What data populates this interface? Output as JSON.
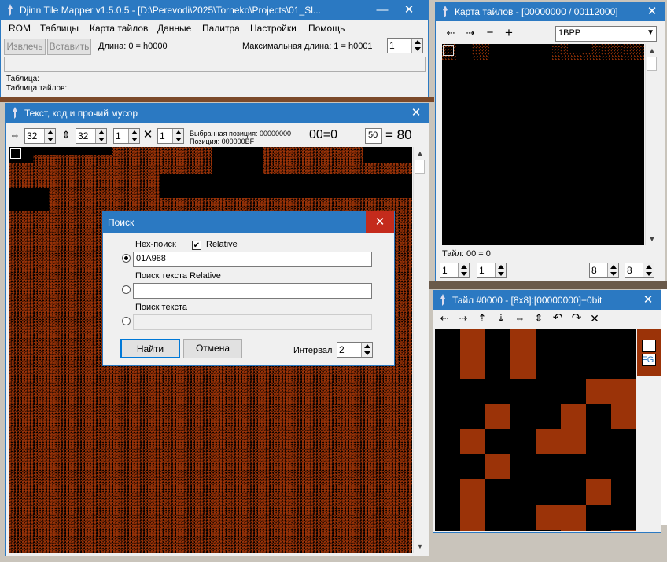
{
  "main": {
    "title": "Djinn Tile Mapper v1.5.0.5 - [D:\\Perevodi\\2025\\Torneko\\Projects\\01_Sl...",
    "menu": [
      "ROM",
      "Таблицы",
      "Карта тайлов",
      "Данные",
      "Палитра",
      "Настройки",
      "Помощь"
    ],
    "extract_label": "Извлечь",
    "insert_label": "Вставить",
    "length": "Длина: 0 = h0000",
    "max_length": "Максимальная длина: 1 = h0001",
    "count_value": "1",
    "table_label": "Таблица:",
    "tile_table_label": "Таблица тайлов:"
  },
  "textwin": {
    "title": "Текст, код и прочий мусор",
    "width": "32",
    "height": "32",
    "v1": "1",
    "v2": "1",
    "selected_pos": "Выбранная позиция: 00000000",
    "position": "Позиция: 000000BF",
    "equation": "00=0",
    "byte_value": "50",
    "byte_result": "= 80"
  },
  "search": {
    "title": "Поиск",
    "hex_label": "Hex-поиск",
    "relative_label": "Relative",
    "relative_checked": true,
    "hex_value": "01A988",
    "text_relative_label": "Поиск текста Relative",
    "text_relative_value": "",
    "text_label": "Поиск текста",
    "text_value": "",
    "find_label": "Найти",
    "cancel_label": "Отмена",
    "interval_label": "Интервал",
    "interval_value": "2"
  },
  "tilemap": {
    "title": "Карта тайлов - [00000000 / 00112000]",
    "format": "1BPP",
    "status": "Тайл: 00 = 0",
    "s1": "1",
    "s2": "1",
    "s3": "8",
    "s4": "8"
  },
  "tilewin": {
    "title": "Тайл #0000 - [8x8]:[00000000]+0bit",
    "fg_label": "FG",
    "pixels": [
      "01010000",
      "01010000",
      "00000011",
      "00100101",
      "01001100",
      "00100000",
      "01000010",
      "01001100",
      "01000101"
    ]
  },
  "colors": {
    "accent": "#2b79c2",
    "tile_fg": "#9b3308",
    "tile_bg": "#000000"
  },
  "icons": {
    "close": "✕",
    "minimize": "—",
    "scroll_up": "▲",
    "scroll_down": "▼",
    "arrow_left": "⇠",
    "arrow_right": "⇢",
    "arrow_up": "⇡",
    "arrow_down": "⇣",
    "arrow_lr": "⇔",
    "arrow_ud": "⇕",
    "rotate_left": "↶",
    "rotate_right": "↷",
    "cross": "✕",
    "plus": "+",
    "minus": "−",
    "check": "✔"
  }
}
